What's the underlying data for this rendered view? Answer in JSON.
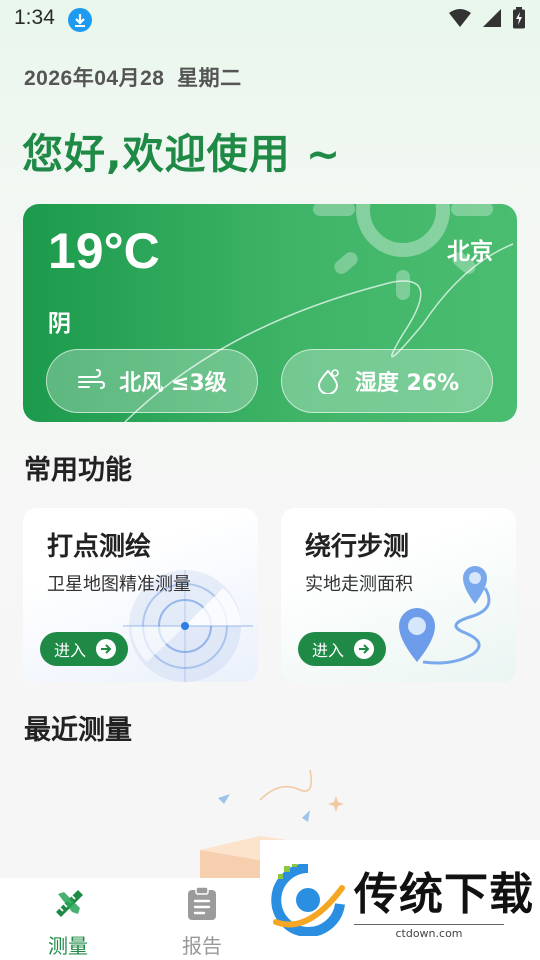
{
  "status_bar": {
    "time": "1:34",
    "icons": [
      "download-icon",
      "wifi-icon",
      "signal-icon",
      "battery-icon"
    ]
  },
  "header": {
    "date": "2026年04月28",
    "weekday": "星期二",
    "greeting": "您好,欢迎使用 ~"
  },
  "weather": {
    "temperature": "19°C",
    "city": "北京",
    "condition": "阴",
    "wind": "北风 ≤3级",
    "humidity": "湿度 26%"
  },
  "features": {
    "section_title": "常用功能",
    "items": [
      {
        "title": "打点测绘",
        "subtitle": "卫星地图精准测量",
        "button": "进入"
      },
      {
        "title": "绕行步测",
        "subtitle": "实地走测面积",
        "button": "进入"
      }
    ]
  },
  "recent": {
    "section_title": "最近测量"
  },
  "bottom_nav": {
    "items": [
      {
        "label": "测量",
        "icon": "ruler-pencil-icon",
        "active": true
      },
      {
        "label": "报告",
        "icon": "clipboard-icon",
        "active": false
      }
    ]
  },
  "watermark": {
    "text": "传统下载",
    "url": "ctdown.com"
  },
  "colors": {
    "brand_green": "#1e8a45",
    "card_green": "#3fb467",
    "download_blue": "#1e9bf0"
  }
}
